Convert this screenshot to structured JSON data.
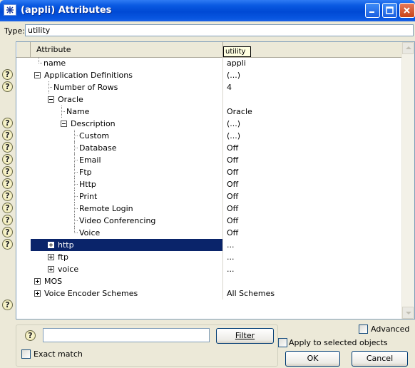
{
  "window": {
    "title": "(appli) Attributes",
    "icon": "network-icon"
  },
  "type_field": {
    "label": "Type:",
    "value": "utility"
  },
  "tooltip": "utility",
  "columns": {
    "attribute": "Attribute",
    "value": "Value"
  },
  "rows": [
    {
      "label": "name",
      "value": "appli",
      "help": true
    },
    {
      "label": "Application Definitions",
      "value": "(...)",
      "help": true
    },
    {
      "label": "Number of Rows",
      "value": "4",
      "help": false
    },
    {
      "label": "Oracle",
      "value": "",
      "help": false
    },
    {
      "label": "Name",
      "value": "Oracle",
      "help": true
    },
    {
      "label": "Description",
      "value": "(...)",
      "help": true
    },
    {
      "label": "Custom",
      "value": "(...)",
      "help": true
    },
    {
      "label": "Database",
      "value": "Off",
      "help": true
    },
    {
      "label": "Email",
      "value": "Off",
      "help": true
    },
    {
      "label": "Ftp",
      "value": "Off",
      "help": true
    },
    {
      "label": "Http",
      "value": "Off",
      "help": true
    },
    {
      "label": "Print",
      "value": "Off",
      "help": true
    },
    {
      "label": "Remote Login",
      "value": "Off",
      "help": true
    },
    {
      "label": "Video Conferencing",
      "value": "Off",
      "help": true
    },
    {
      "label": "Voice",
      "value": "Off",
      "help": true
    },
    {
      "label": "http",
      "value": "...",
      "help": false
    },
    {
      "label": "ftp",
      "value": "...",
      "help": false
    },
    {
      "label": "voice",
      "value": "...",
      "help": false
    },
    {
      "label": "MOS",
      "value": "",
      "help": false
    },
    {
      "label": "Voice Encoder Schemes",
      "value": "All Schemes",
      "help": true
    }
  ],
  "bottom": {
    "help_symbol": "?",
    "filter_value": "",
    "filter_button": "Filter",
    "exact_match": "Exact match",
    "advanced": "Advanced",
    "apply_selected": "Apply to selected objects",
    "ok": "OK",
    "cancel": "Cancel"
  },
  "help_symbol": "?"
}
